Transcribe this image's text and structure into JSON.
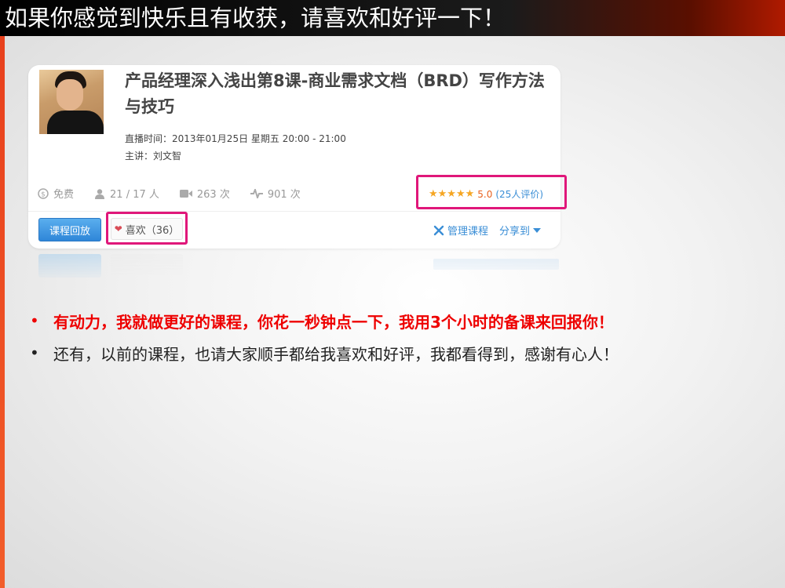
{
  "slide": {
    "title": "如果你感觉到快乐且有收获，请喜欢和好评一下！"
  },
  "course": {
    "title": "产品经理深入浅出第8课-商业需求文档（BRD）写作方法与技巧",
    "time": "直播时间：2013年01月25日 星期五 20:00 - 21:00",
    "teacher": "主讲：刘文智",
    "stats": {
      "price": "免费",
      "students": "21 / 17 人",
      "videos": "263 次",
      "views": "901 次"
    },
    "rating": {
      "stars": "★★★★★",
      "score": "5.0",
      "reviews": "(25人评价)"
    },
    "buttons": {
      "replay": "课程回放",
      "like": "喜欢（36）",
      "manage": "管理课程",
      "share": "分享到"
    }
  },
  "bullets": [
    "有动力，我就做更好的课程，你花一秒钟点一下，我用3个小时的备课来回报你！",
    "还有，以前的课程，也请大家顺手都给我喜欢和好评，我都看得到，感谢有心人！"
  ],
  "colors": {
    "accent_red": "#e00000",
    "highlight_box": "#e0177a",
    "link_blue": "#3a8ed6",
    "star_orange": "#f5a623"
  }
}
